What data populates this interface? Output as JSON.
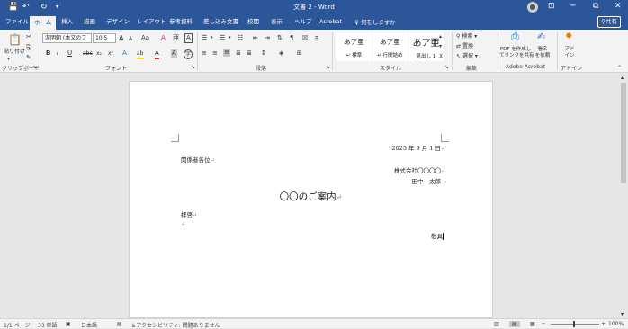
{
  "titlebar": {
    "doc_title": "文書 2 - Word",
    "save_icon": "💾",
    "undo_icon": "↶",
    "redo_icon": "↻",
    "customize_icon": "▾",
    "minimize_icon": "─",
    "restore_icon": "⧉",
    "close_icon": "✕",
    "ribbon_display_icon": "⊡",
    "avatar_icon": "●"
  },
  "tabs": [
    "ファイル",
    "ホーム",
    "挿入",
    "描画",
    "デザイン",
    "レイアウト",
    "参考資料",
    "差し込み文書",
    "校閲",
    "表示",
    "ヘルプ",
    "Acrobat"
  ],
  "active_tab": "ホーム",
  "tell_me": "何をしますか",
  "share_label": "共有",
  "ribbon": {
    "clipboard": {
      "paste_label": "貼り付け",
      "group_label": "クリップボード"
    },
    "font": {
      "font_name": "游明朝 (本文のフ",
      "font_size": "10.5",
      "grow": "A",
      "shrink": "A",
      "change_case": "Aa",
      "clear_format": "A",
      "phonetic": "亜",
      "char_border": "A",
      "bold": "B",
      "italic": "I",
      "underline": "U",
      "strike": "abc",
      "subscript": "x₂",
      "superscript": "x²",
      "effects": "A",
      "highlight": "ab",
      "font_color": "A",
      "char_shading": "A",
      "enclosed": "字",
      "group_label": "フォント"
    },
    "paragraph": {
      "group_label": "段落"
    },
    "styles": {
      "items": [
        {
          "sample": "あア亜",
          "name": "↵ 標準"
        },
        {
          "sample": "あア亜",
          "name": "↵ 行間詰め"
        },
        {
          "sample": "あア亜",
          "name": "見出し 1"
        }
      ],
      "group_label": "スタイル"
    },
    "editing": {
      "find": "検索",
      "replace": "置換",
      "select": "選択",
      "group_label": "編集"
    },
    "acrobat": {
      "create_pdf": "PDF を作成し\nてリンクを共有",
      "sign": "署名\nを依頼",
      "group_label": "Adobe Acrobat"
    },
    "addins": {
      "addin": "アド\nイン",
      "group_label": "アドイン"
    }
  },
  "document": {
    "date": "2025 年 9 月 1 日",
    "addressee": "関係者各位",
    "company": "株式会社〇〇〇〇",
    "author": "田中　太郎",
    "title": "〇〇のご案内",
    "salutation": "拝啓",
    "closing": "敬具",
    "para_mark": "↵"
  },
  "statusbar": {
    "page": "1/1 ページ",
    "words": "33 単語",
    "language": "日本語",
    "accessibility": "アクセシビリティ: 問題ありません",
    "focus": "フォーカス",
    "zoom": "100%",
    "zoom_minus": "─",
    "zoom_plus": "+"
  },
  "colors": {
    "word_blue": "#2b579a",
    "ribbon_bg": "#f3f3f3",
    "canvas": "#e6e6e6"
  }
}
